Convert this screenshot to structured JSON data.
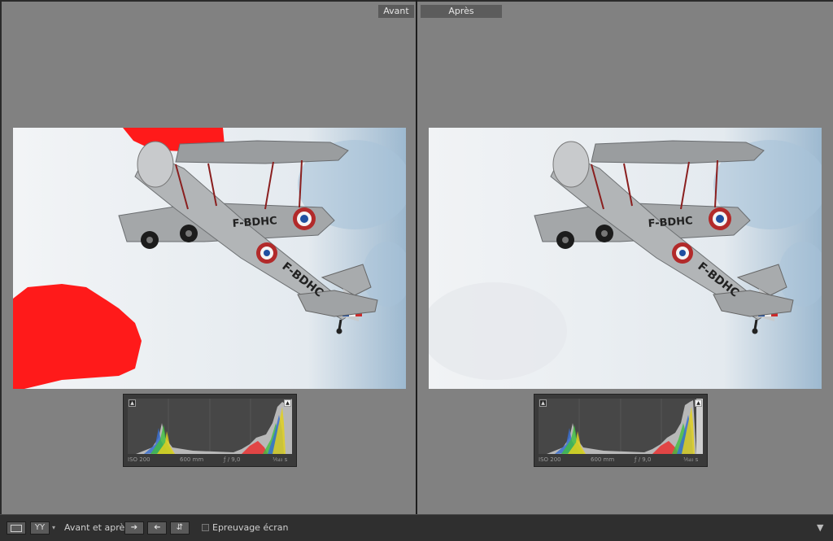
{
  "before_tab": "Avant",
  "after_tab": "Après",
  "before": {
    "iso": "ISO 200",
    "focal": "600 mm",
    "aperture": "ƒ / 9,0",
    "shutter": "¹⁄₆₄₀ s",
    "plane_reg": "F-BDHC"
  },
  "after": {
    "iso": "ISO 200",
    "focal": "600 mm",
    "aperture": "ƒ / 9,0",
    "shutter": "¹⁄₆₄₀ s",
    "plane_reg": "F-BDHC"
  },
  "toolbar": {
    "view_mode_icon": "single-view-icon",
    "before_after_label": "YY",
    "compare_label": "Avant et après :",
    "proof_label": "Epreuvage écran"
  },
  "colors": {
    "highlight_clip": "#ff1a1a",
    "panel_bg": "#818181",
    "toolbar_bg": "#2f2f2f"
  }
}
